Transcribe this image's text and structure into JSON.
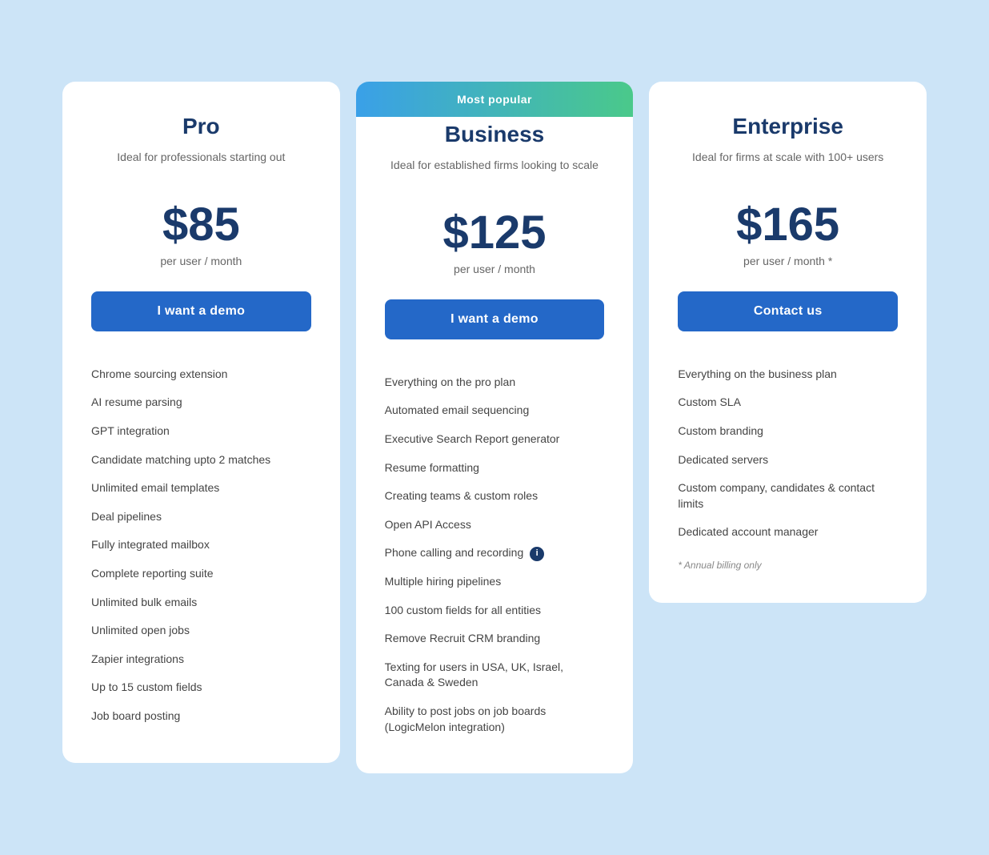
{
  "plans": [
    {
      "id": "pro",
      "title": "Pro",
      "subtitle": "Ideal for professionals starting out",
      "price": "$85",
      "period": "per user / month",
      "cta": "I want a demo",
      "popular": false,
      "features": [
        "Chrome sourcing extension",
        "AI resume parsing",
        "GPT integration",
        "Candidate matching upto 2 matches",
        "Unlimited email templates",
        "Deal pipelines",
        "Fully integrated mailbox",
        "Complete reporting suite",
        "Unlimited bulk emails",
        "Unlimited open jobs",
        "Zapier integrations",
        "Up to 15 custom fields",
        "Job board posting"
      ],
      "annual_note": null
    },
    {
      "id": "business",
      "title": "Business",
      "subtitle": "Ideal for established firms looking to scale",
      "price": "$125",
      "period": "per user / month",
      "cta": "I want a demo",
      "popular": true,
      "popular_label": "Most popular",
      "features": [
        "Everything on the pro plan",
        "Automated email sequencing",
        "Executive Search Report generator",
        "Resume formatting",
        "Creating teams & custom roles",
        "Open API Access",
        "Phone calling and recording",
        "Multiple hiring pipelines",
        "100 custom fields for all entities",
        "Remove Recruit CRM branding",
        "Texting for users in USA, UK, Israel, Canada & Sweden",
        "Ability to post jobs on job boards (LogicMelon integration)"
      ],
      "has_info_icon": "Phone calling and recording",
      "annual_note": null
    },
    {
      "id": "enterprise",
      "title": "Enterprise",
      "subtitle": "Ideal for firms at scale with 100+ users",
      "price": "$165",
      "period": "per user / month *",
      "cta": "Contact us",
      "popular": false,
      "features": [
        "Everything on the business plan",
        "Custom SLA",
        "Custom branding",
        "Dedicated servers",
        "Custom company, candidates & contact limits",
        "Dedicated account manager"
      ],
      "annual_note": "* Annual billing only"
    }
  ]
}
